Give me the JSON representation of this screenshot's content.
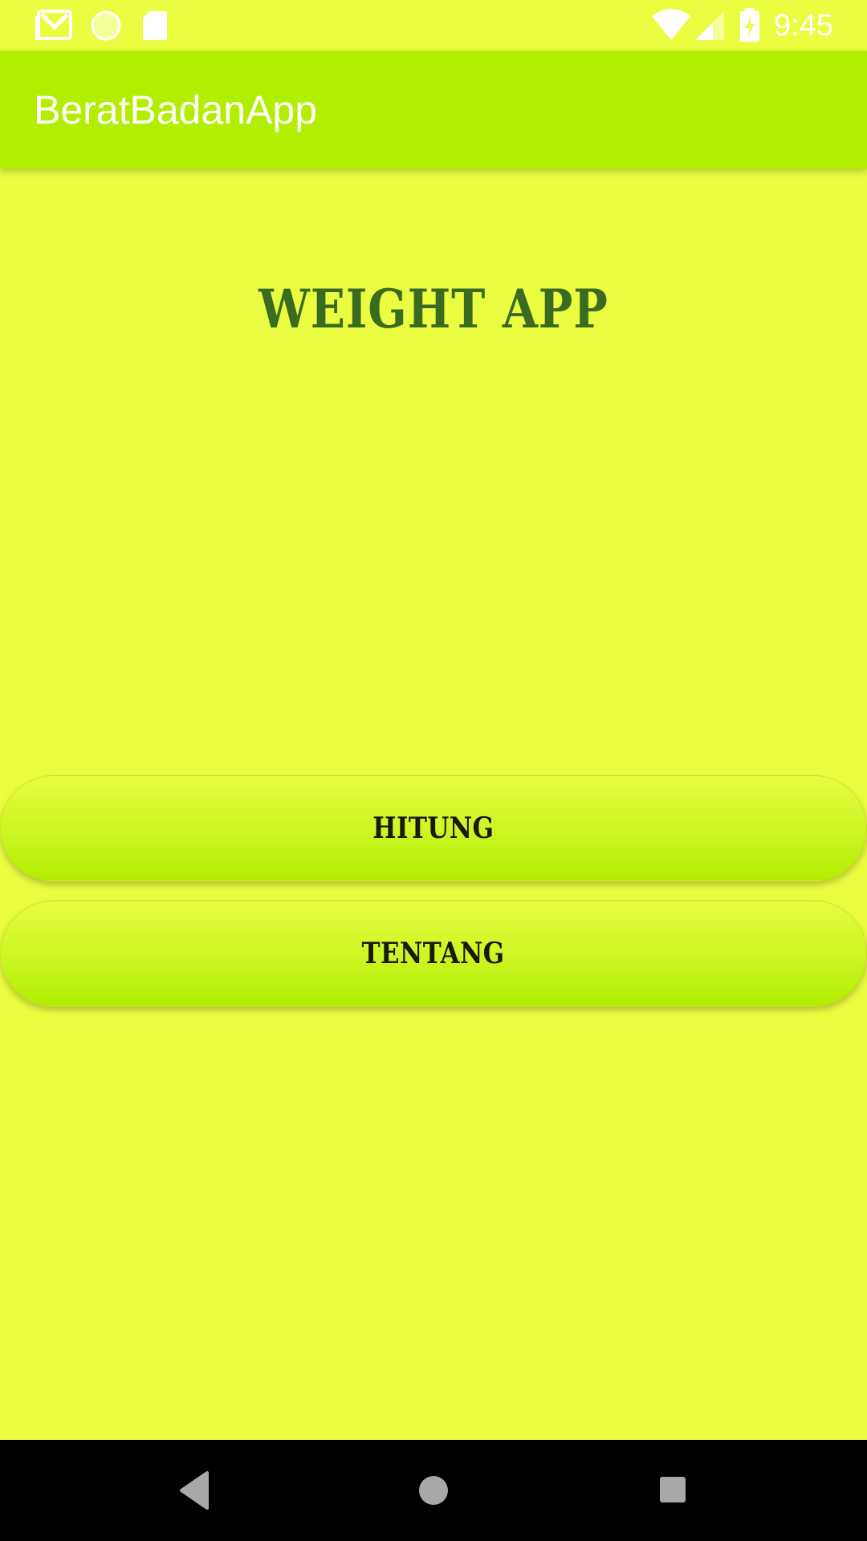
{
  "status_bar": {
    "time": "9:45",
    "icons": [
      "gmail-icon",
      "sync-circle-icon",
      "sd-card-icon",
      "wifi-icon",
      "signal-icon",
      "battery-charging-icon"
    ]
  },
  "app_bar": {
    "title": "BeratBadanApp"
  },
  "main": {
    "headline": "WEIGHT APP",
    "buttons": {
      "hitung": "HITUNG",
      "tentang": "TENTANG"
    }
  },
  "nav_bar": {
    "icons": [
      "back-icon",
      "home-icon",
      "recents-icon"
    ]
  },
  "colors": {
    "background": "#ebfd40",
    "app_bar": "#b2ee00",
    "headline": "#3b6b20",
    "button_text": "#1a1a08"
  }
}
